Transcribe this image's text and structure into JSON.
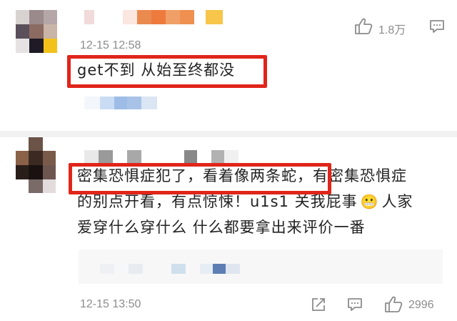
{
  "comments": [
    {
      "timestamp": "12-15 12:58",
      "text": "get不到 从始至终都没",
      "like_count": "1.8万",
      "icons": [
        "thumbs-up-icon",
        "comment-icon"
      ]
    },
    {
      "text_line1_highlighted": "密集恐惧症犯了，看着像两条蛇，",
      "text_line1_rest": "有密集恐惧症",
      "text_line2": "的别点开看，有点惊悚！u1s1 关我屁事",
      "text_line2_end": "人家",
      "text_line3": "爱穿什么穿什么 什么都要拿出来评价一番",
      "emoji": "😬",
      "timestamp": "12-15 13:50",
      "like_count": "2996",
      "icons": [
        "share-icon",
        "comment-icon",
        "thumbs-up-icon"
      ]
    }
  ],
  "colors": {
    "highlight_border": "#e0251a",
    "meta_text": "#8c8c8c",
    "divider": "#f2f2f2"
  }
}
